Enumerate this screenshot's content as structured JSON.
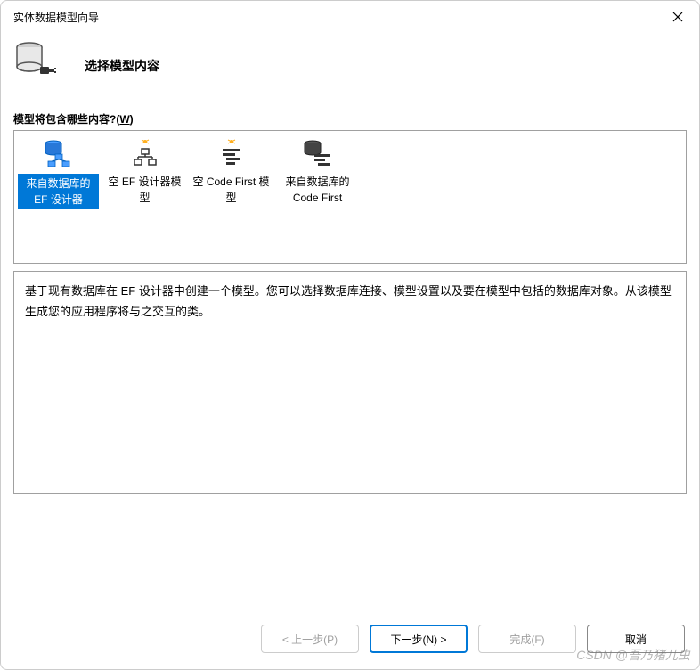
{
  "titlebar": {
    "title": "实体数据模型向导"
  },
  "header": {
    "title": "选择模型内容"
  },
  "prompt": {
    "text_prefix": "模型将包含哪些内容?(",
    "mnemonic": "W",
    "text_suffix": ")"
  },
  "options": [
    {
      "label": "来自数据库的 EF 设计器",
      "selected": true,
      "icon": "db-designer"
    },
    {
      "label": "空 EF 设计器模型",
      "selected": false,
      "icon": "empty-designer"
    },
    {
      "label": "空 Code First 模型",
      "selected": false,
      "icon": "empty-codefirst"
    },
    {
      "label": "来自数据库的 Code First",
      "selected": false,
      "icon": "db-codefirst"
    }
  ],
  "description": "基于现有数据库在 EF 设计器中创建一个模型。您可以选择数据库连接、模型设置以及要在模型中包括的数据库对象。从该模型生成您的应用程序将与之交互的类。",
  "buttons": {
    "previous": "< 上一步(P)",
    "next": "下一步(N) >",
    "finish": "完成(F)",
    "cancel": "取消"
  },
  "watermark": "CSDN @吾乃猪儿虫"
}
